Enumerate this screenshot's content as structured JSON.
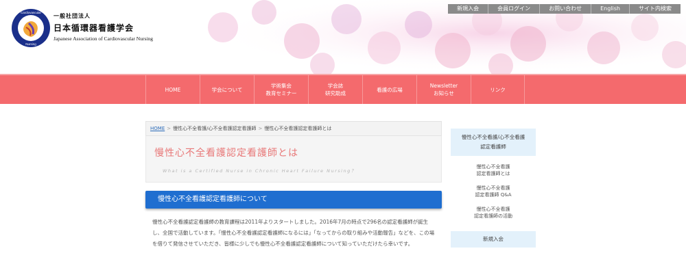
{
  "header": {
    "logo_small": "一般社団法人",
    "logo_main": "日本循環器看護学会",
    "logo_en": "Japanese Association of Cardiovascular Nursing"
  },
  "topnav": [
    "新規入会",
    "会員ログイン",
    "お問い合わせ",
    "English",
    "サイト内検索"
  ],
  "mainnav": [
    [
      "HOME"
    ],
    [
      "学会について"
    ],
    [
      "学術集会",
      "教育セミナー"
    ],
    [
      "学会誌",
      "研究助成"
    ],
    [
      "看護の広場"
    ],
    [
      "Newsletter",
      "お知らせ"
    ],
    [
      "リンク"
    ]
  ],
  "breadcrumb": {
    "home": "HOME",
    "sep": ">",
    "level1": "慢性心不全看護/心不全看護認定看護師",
    "level2": "慢性心不全看護認定看護師とは"
  },
  "page": {
    "title_jp": "慢性心不全看護認定看護師とは",
    "title_en": "What is a Certified Nurse in Chronic Heart Failure Nursing？"
  },
  "section": {
    "heading": "慢性心不全看護認定看護師について",
    "body": "慢性心不全看護認定看護師の教育課程は2011年よりスタートしました。2016年7月の時点で296名の認定看護師が誕生し、全国で活動しています。「慢性心不全看護認定看護師になるには」「なってからの取り組みや活動報告」などを、この場を借りて発信させていただき、皆様に少しでも慢性心不全看護認定看護師について知っていただけたら幸いです。"
  },
  "sidebar": {
    "heading": [
      "慢性心不全看護/心不全看護",
      "認定看護師"
    ],
    "items": [
      [
        "慢性心不全看護",
        "認定看護師とは"
      ],
      [
        "慢性心不全看護",
        "認定看護師 Q&A"
      ],
      [
        "慢性心不全看護",
        "認定看護師の活動"
      ]
    ],
    "join": "新規入会"
  },
  "colors": {
    "nav_bg": "#f46a6d",
    "section_blue": "#1f6ed0",
    "title_pink": "#e87878",
    "sidebar_bg": "#e3f1fb"
  }
}
